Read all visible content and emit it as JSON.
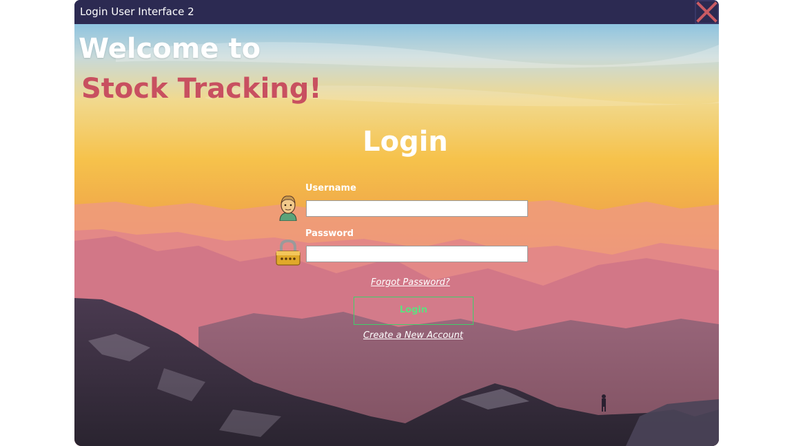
{
  "window": {
    "title": "Login User Interface 2",
    "close_icon": "close-x-icon"
  },
  "hero": {
    "welcome": "Welcome to",
    "brand": "Stock Tracking!"
  },
  "form": {
    "heading": "Login",
    "username_label": "Username",
    "username_value": "",
    "username_icon": "user-avatar-icon",
    "password_label": "Password",
    "password_value": "",
    "password_icon": "padlock-icon",
    "forgot_link": "Forgot Password?",
    "login_button": "Login",
    "create_link": "Create a New Account"
  },
  "colors": {
    "titlebar": "#2c2a52",
    "brand": "#c85060",
    "button_border": "#3fd06a",
    "close_icon": "#c95b63"
  }
}
